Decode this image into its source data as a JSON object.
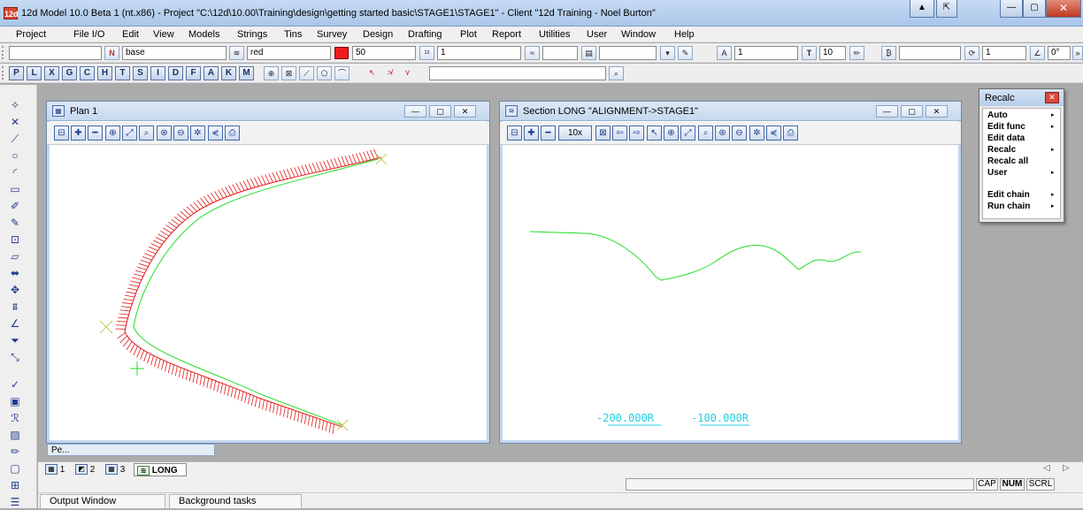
{
  "window": {
    "app_icon_text": "12d",
    "title": "12d Model 10.0 Beta 1 (nt.x86) - Project \"C:\\12d\\10.00\\Training\\design\\getting started basic\\STAGE1\\STAGE1\" - Client \"12d Training - Noel Burton\""
  },
  "menu": [
    "Project",
    "File I/O",
    "Edit",
    "View",
    "Models",
    "Strings",
    "Tins",
    "Survey",
    "Design",
    "Drafting",
    "Plot",
    "Report",
    "Utilities",
    "User",
    "Window",
    "Help"
  ],
  "toolbar1": {
    "model_value": "",
    "name_value": "base",
    "colour_value": "red",
    "colour_hex": "#ee1c1c",
    "weight_value": "50",
    "level_value": "1",
    "linestyle_value": "",
    "symbol_value": "",
    "text_size_value": "10",
    "field_a_value": "1",
    "field_b_value": "",
    "field_c_value": "1",
    "angle_value": "0°"
  },
  "toolbar2": {
    "letters": [
      "P",
      "L",
      "X",
      "G",
      "C",
      "H",
      "T",
      "S",
      "I",
      "D",
      "F",
      "A",
      "K",
      "M"
    ],
    "search_value": ""
  },
  "plan_window": {
    "title": "Plan 1",
    "tab_stub": "Pe..."
  },
  "section_window": {
    "title": "Section LONG \"ALIGNMENT->STAGE1\"",
    "zoom_label": "10x",
    "radius_labels": [
      "-200.000R",
      "-100.000R"
    ]
  },
  "recalc": {
    "title": "Recalc",
    "items": [
      {
        "label": "Auto",
        "submenu": "▸"
      },
      {
        "label": "Edit func",
        "submenu": "▸"
      },
      {
        "label": "Edit data",
        "submenu": ""
      },
      {
        "label": "Recalc",
        "submenu": "▸"
      },
      {
        "label": "Recalc all",
        "submenu": ""
      },
      {
        "label": "User",
        "submenu": "▸"
      },
      {
        "label": "Edit chain",
        "submenu": "▸"
      },
      {
        "label": "Run chain",
        "submenu": "▸"
      }
    ]
  },
  "tabs": [
    {
      "label": "1",
      "icon": "plan-icon"
    },
    {
      "label": "2",
      "icon": "perspective-icon"
    },
    {
      "label": "3",
      "icon": "plan-icon"
    },
    {
      "label": "LONG",
      "icon": "section-icon"
    }
  ],
  "tab_scroll": {
    "left": "◁",
    "right": "▷"
  },
  "status": {
    "caps": "CAP",
    "num": "NUM",
    "scroll": "SCRL"
  },
  "output": {
    "output_window": "Output Window",
    "background_tasks": "Background tasks"
  },
  "colors": {
    "string_red": "#e11a1a",
    "string_green": "#22dd22",
    "cross_green": "#bfcc55"
  }
}
